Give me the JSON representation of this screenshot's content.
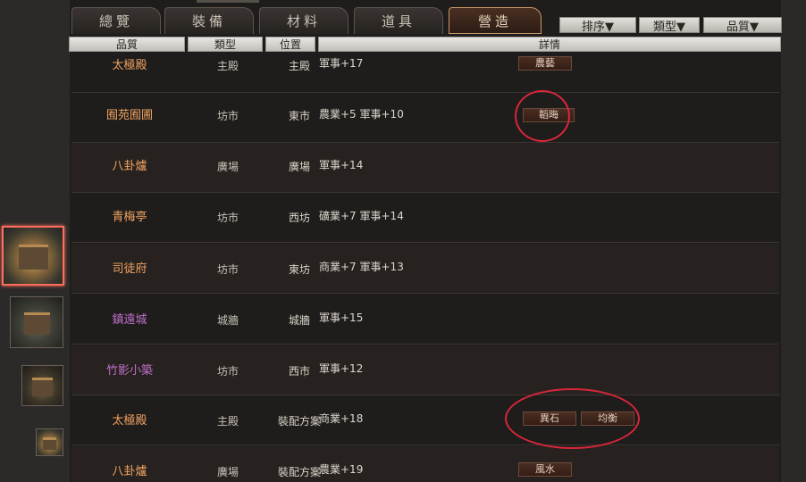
{
  "tabs": [
    {
      "label": "總覽"
    },
    {
      "label": "裝備"
    },
    {
      "label": "材料"
    },
    {
      "label": "道具"
    },
    {
      "label": "營造",
      "active": true
    }
  ],
  "sort_buttons": [
    {
      "label": "排序▼"
    },
    {
      "label": "類型▼"
    },
    {
      "label": "品質▼"
    }
  ],
  "columns": {
    "quality": "品質",
    "type": "類型",
    "position": "位置",
    "detail": "詳情"
  },
  "rows": [
    {
      "name": "太極殿",
      "type": "主殿",
      "position": "主殿",
      "detail": "軍事+17",
      "tags": [
        "農藝"
      ],
      "quality": "gold"
    },
    {
      "name": "囿苑囿圃",
      "type": "坊市",
      "position": "東市",
      "detail": "農業+5  軍事+10",
      "tags": [
        "韜晦"
      ],
      "quality": "gold"
    },
    {
      "name": "八卦爐",
      "type": "廣場",
      "position": "廣場",
      "detail": "軍事+14",
      "tags": [],
      "quality": "gold"
    },
    {
      "name": "青梅亭",
      "type": "坊市",
      "position": "西坊",
      "detail": "礦業+7  軍事+14",
      "tags": [],
      "quality": "gold"
    },
    {
      "name": "司徒府",
      "type": "坊市",
      "position": "東坊",
      "detail": "商業+7  軍事+13",
      "tags": [],
      "quality": "gold"
    },
    {
      "name": "鎮遠城",
      "type": "城牆",
      "position": "城牆",
      "detail": "軍事+15",
      "tags": [],
      "quality": "purple"
    },
    {
      "name": "竹影小築",
      "type": "坊市",
      "position": "西市",
      "detail": "軍事+12",
      "tags": [],
      "quality": "purple"
    },
    {
      "name": "太極殿",
      "type": "主殿",
      "position": "裝配方案",
      "detail": "商業+18",
      "tags": [
        "異石",
        "均衡"
      ],
      "quality": "gold"
    },
    {
      "name": "八卦爐",
      "type": "廣場",
      "position": "裝配方案",
      "detail": "農業+19",
      "tags": [
        "風水"
      ],
      "quality": "gold"
    }
  ],
  "colors": {
    "gold_quality": "#f0a262",
    "purple_quality": "#c070cc",
    "highlight_circle": "#d8263a",
    "selected_thumb": "#ff6d5e"
  }
}
